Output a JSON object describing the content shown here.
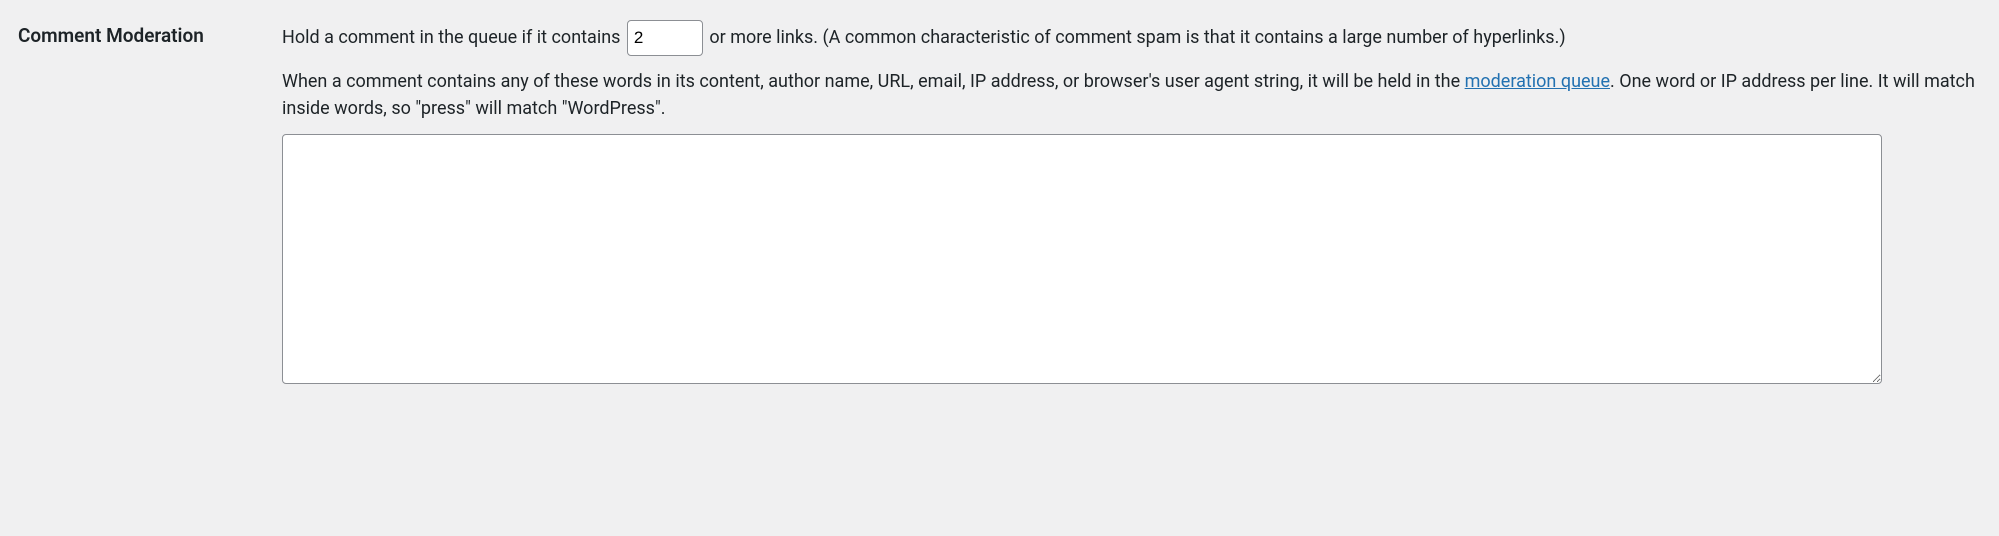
{
  "section": {
    "heading": "Comment Moderation"
  },
  "links": {
    "text_before": "Hold a comment in the queue if it contains ",
    "value": "2",
    "text_after": " or more links. (A common characteristic of comment spam is that it contains a large number of hyperlinks.)"
  },
  "keys": {
    "desc_before": "When a comment contains any of these words in its content, author name, URL, email, IP address, or browser's user agent string, it will be held in the ",
    "link_text": "moderation queue",
    "desc_after": ". One word or IP address per line. It will match inside words, so \"press\" will match \"WordPress\".",
    "value": ""
  }
}
